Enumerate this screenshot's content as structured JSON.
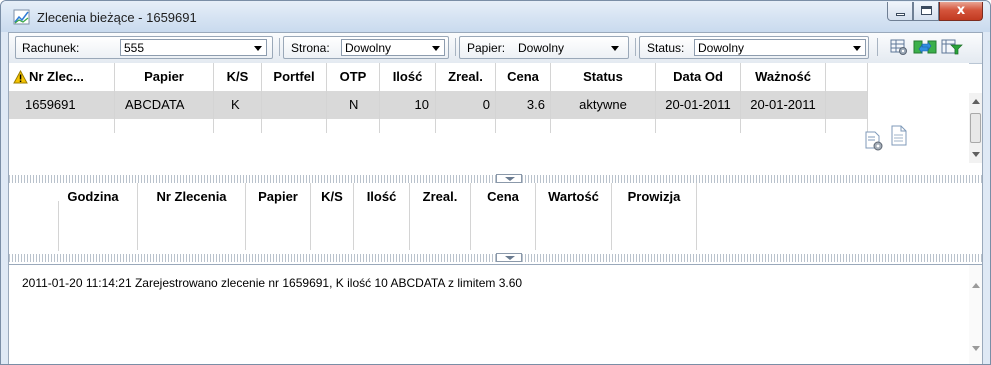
{
  "window": {
    "title": "Zlecenia bieżące - 1659691",
    "close_glyph": "x"
  },
  "toolbar": {
    "rachunek_label": "Rachunek:",
    "rachunek_value": "555",
    "strona_label": "Strona:",
    "strona_value": "Dowolny",
    "papier_label": "Papier:",
    "papier_value": "Dowolny",
    "status_label": "Status:",
    "status_value": "Dowolny"
  },
  "orders": {
    "columns": [
      "Nr Zlec...",
      "Papier",
      "K/S",
      "Portfel",
      "OTP",
      "Ilość",
      "Zreal.",
      "Cena",
      "Status",
      "Data Od",
      "Ważność"
    ],
    "rows": [
      {
        "nr": "1659691",
        "papier": "ABCDATA",
        "ks": "K",
        "portfel": "",
        "otp": "N",
        "ilosc": "10",
        "zreal": "0",
        "cena": "3.6",
        "status": "aktywne",
        "data_od": "20-01-2011",
        "waznosc": "20-01-2011"
      }
    ]
  },
  "transactions": {
    "columns": [
      "Godzina",
      "Nr Zlecenia",
      "Papier",
      "K/S",
      "Ilość",
      "Zreal.",
      "Cena",
      "Wartość",
      "Prowizja"
    ]
  },
  "log": {
    "lines": [
      "2011-01-20 11:14:21   Zarejestrowano zlecenie nr 1659691, K ilość 10 ABCDATA z limitem 3.60"
    ]
  },
  "icons": {
    "app": "chart-icon",
    "warning": "warning-icon",
    "row_action1": "order-settings-icon",
    "row_action2": "order-document-icon",
    "tool1": "grid-settings-icon",
    "tool2": "refresh-arrows-icon",
    "tool3": "filter-icon"
  },
  "colors": {
    "selected_row": "#d9d9d9",
    "title_bar": "#d7e4f3",
    "close_button": "#c94a2e"
  }
}
